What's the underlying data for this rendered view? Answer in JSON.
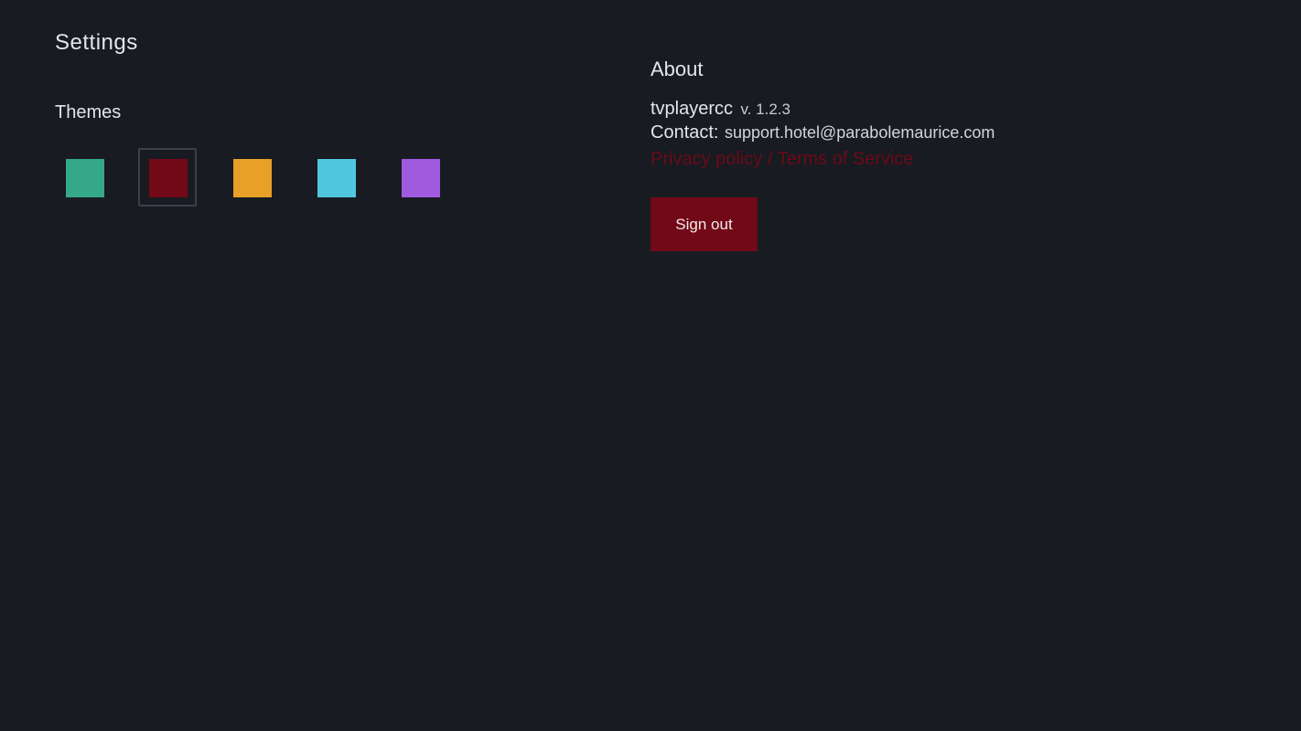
{
  "settings": {
    "title": "Settings"
  },
  "themes": {
    "heading": "Themes",
    "selected_index": 1,
    "swatches": [
      {
        "name": "teal",
        "color": "#36a88a"
      },
      {
        "name": "crimson",
        "color": "#720917"
      },
      {
        "name": "amber",
        "color": "#e8a026"
      },
      {
        "name": "sky",
        "color": "#51c7de"
      },
      {
        "name": "violet",
        "color": "#a05ae0"
      }
    ]
  },
  "about": {
    "heading": "About",
    "app_name": "tvplayercc",
    "version": "v. 1.2.3",
    "contact_label": "Contact:",
    "contact_email": "support.hotel@parabolemaurice.com",
    "privacy_link": "Privacy policy",
    "separator": " / ",
    "terms_link": "Terms of Service",
    "link_color": "#6b0a18"
  },
  "signout": {
    "label": "Sign out",
    "color": "#720917"
  }
}
